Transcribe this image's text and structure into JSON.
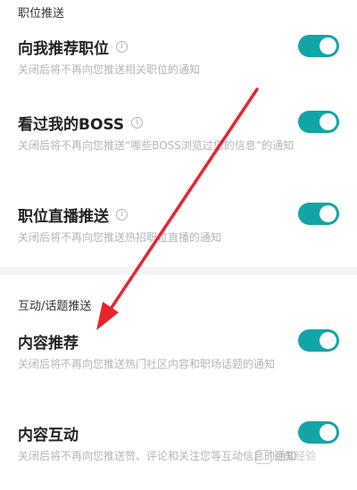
{
  "sections": [
    {
      "header": "职位推送"
    },
    {
      "header": "互动/话题推送"
    }
  ],
  "rows": [
    {
      "title": "向我推荐职位",
      "has_info": true,
      "desc": "关闭后将不再向您推送相关职位的通知",
      "enabled": true
    },
    {
      "title": "看过我的BOSS",
      "has_info": true,
      "desc": "关闭后将不再向您推送“哪些BOSS浏览过您的信息”的通知",
      "enabled": true
    },
    {
      "title": "职位直播推送",
      "has_info": true,
      "desc": "关闭后将不再向您推送热招职位直播的通知",
      "enabled": true
    },
    {
      "title": "内容推荐",
      "has_info": false,
      "desc": "关闭后将不再向您推送热门社区内容和职场话题的通知",
      "enabled": true
    },
    {
      "title": "内容互动",
      "has_info": false,
      "desc": "关闭后将不再向您推送赞、评论和关注您等互动信息的通知",
      "enabled": true
    }
  ],
  "info_glyph": "i",
  "colors": {
    "toggle_on": "#12a5a8",
    "arrow": "#e8232f"
  },
  "watermark": {
    "icon": "baidu-jingyan-logo-icon",
    "text": "百度经验"
  }
}
